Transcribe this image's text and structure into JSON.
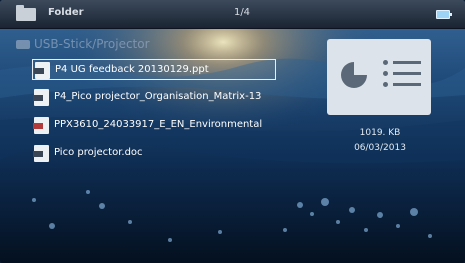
{
  "header": {
    "title": "Folder",
    "page_indicator": "1/4"
  },
  "location": {
    "label": "USB-Stick/Projector"
  },
  "files": [
    {
      "name": "P4 UG feedback 20130129.ppt",
      "icon": "ppt-file-icon",
      "selected": true
    },
    {
      "name": "P4_Pico projector_Organisation_Matrix-13",
      "icon": "xls-file-icon",
      "selected": false
    },
    {
      "name": "PPX3610_24033917_E_EN_Environmental",
      "icon": "pdf-file-icon",
      "selected": false
    },
    {
      "name": "Pico projector.doc",
      "icon": "doc-file-icon",
      "selected": false
    }
  ],
  "details": {
    "size": "1019. KB",
    "date": "06/03/2013"
  },
  "colors": {
    "selection_border": "#e8edf2",
    "battery": "#9dd4f5"
  }
}
